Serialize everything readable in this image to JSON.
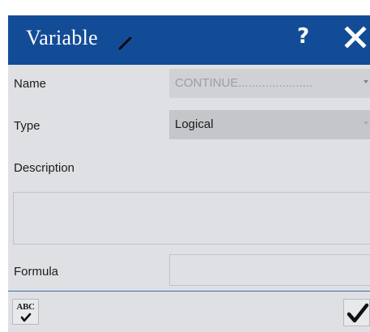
{
  "dialog": {
    "title": "Variable",
    "help_label": "?",
    "icons": {
      "edit": "pencil-icon",
      "close": "close-icon",
      "spell_check": "spell-check-icon",
      "confirm": "checkmark-icon"
    },
    "colors": {
      "titlebar": "#134c96",
      "body": "#dfe0e3",
      "divider": "#3a6fb0"
    }
  },
  "form": {
    "name_label": "Name",
    "name_value": "CONTINUE......................",
    "type_label": "Type",
    "type_value": "Logical",
    "description_label": "Description",
    "description_value": "",
    "formula_label": "Formula",
    "formula_value": ""
  },
  "footer": {
    "spell_check_text": "ABC"
  }
}
